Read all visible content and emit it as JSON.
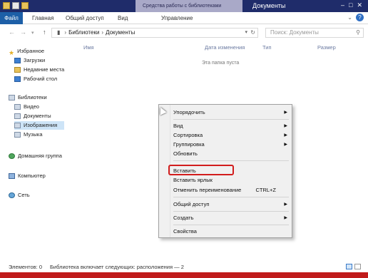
{
  "window": {
    "title": "Документы",
    "context_tab": "Средства работы с библиотеками"
  },
  "ribbon": {
    "tabs": [
      "Файл",
      "Главная",
      "Общий доступ",
      "Вид",
      "Управление"
    ],
    "help": "?"
  },
  "address_bar": {
    "back": "←",
    "forward": "→",
    "dropdown": "▾",
    "up": "↑",
    "path": [
      "Библиотеки",
      "Документы"
    ],
    "search_placeholder": "Поиск: Документы"
  },
  "nav_pane": {
    "favorites_header": "Избранное",
    "favorites": [
      "Загрузки",
      "Недавние места",
      "Рабочий стол"
    ],
    "libraries_header": "Библиотеки",
    "libraries": [
      "Видео",
      "Документы",
      "Изображения",
      "Музыка"
    ],
    "homegroup": "Домашняя группа",
    "computer": "Компьютер",
    "network": "Сеть"
  },
  "content": {
    "columns": [
      "Имя",
      "Дата изменения",
      "Тип",
      "Размер"
    ],
    "empty_message": "Эта папка пуста"
  },
  "context_menu": {
    "items": {
      "arrange": "Упорядочить",
      "view": "Вид",
      "sort": "Сортировка",
      "group": "Группировка",
      "refresh": "Обновить",
      "paste": "Вставить",
      "paste_shortcut": "Вставить ярлык",
      "undo_rename": "Отменить переименование",
      "undo_shortcut": "CTRL+Z",
      "share": "Общий доступ",
      "new": "Создать",
      "properties": "Свойства"
    },
    "highlighted_item": "Вставить"
  },
  "status_bar": {
    "items_count": "Элементов: 0",
    "library_info": "Библиотека включает следующих: расположения — 2"
  },
  "colors": {
    "title_bar": "#1f2c6a",
    "file_tab": "#1d5fa7",
    "highlight_box": "#d21d1d"
  }
}
